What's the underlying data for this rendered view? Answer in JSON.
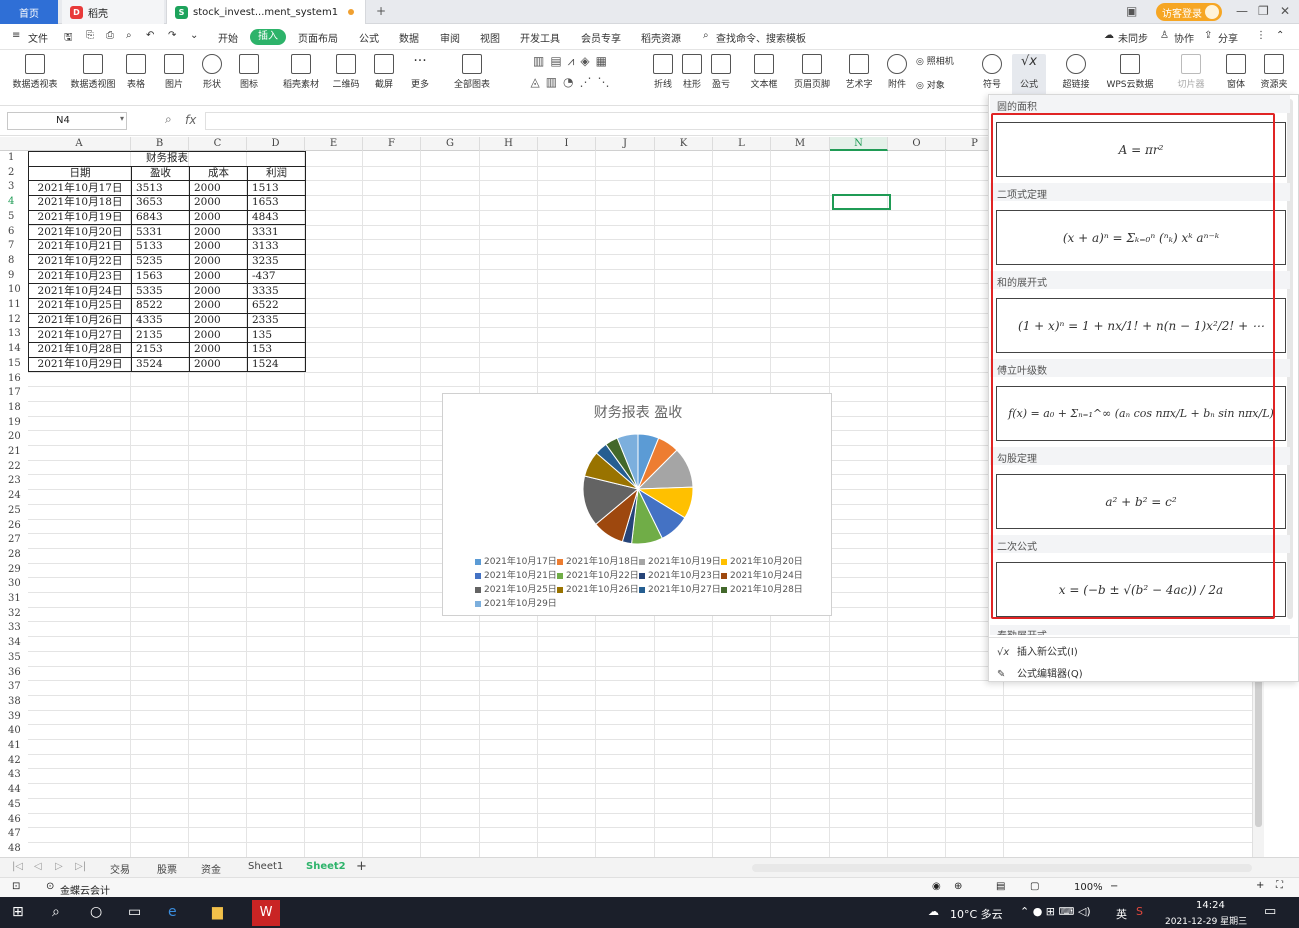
{
  "titlebar": {
    "tabs": [
      {
        "label": "首页"
      },
      {
        "label": "稻壳"
      },
      {
        "label": "stock_invest...ment_system1"
      }
    ],
    "new_tab": "+",
    "login": "访客登录"
  },
  "menubar": {
    "file": "文件",
    "items": [
      "开始",
      "插入",
      "页面布局",
      "公式",
      "数据",
      "审阅",
      "视图",
      "开发工具",
      "会员专享",
      "稻壳资源"
    ],
    "search": "查找命令、搜索模板",
    "unsync": "未同步",
    "collab": "协作",
    "share": "分享"
  },
  "ribbon": {
    "buttons": [
      "数据透视表",
      "数据透视图",
      "表格",
      "图片",
      "形状",
      "图标",
      "稻壳素材",
      "二维码",
      "截屏",
      "更多",
      "全部图表",
      "折线",
      "柱形",
      "盈亏",
      "文本框",
      "页眉页脚",
      "艺术字",
      "附件",
      "照相机",
      "对象",
      "符号",
      "公式",
      "超链接",
      "WPS云数据",
      "切片器",
      "窗体",
      "资源夹"
    ]
  },
  "formulabar": {
    "cell_ref": "N4",
    "fx": "fx"
  },
  "grid": {
    "columns": [
      "A",
      "B",
      "C",
      "D",
      "E",
      "F",
      "G",
      "H",
      "I",
      "J",
      "K",
      "L",
      "M",
      "N",
      "O",
      "P"
    ],
    "rows": [
      "1",
      "2",
      "3",
      "4",
      "5",
      "6",
      "7",
      "8",
      "9",
      "10",
      "11",
      "12",
      "13",
      "14",
      "15",
      "16",
      "17",
      "18",
      "19",
      "20",
      "21",
      "22",
      "23",
      "24",
      "25",
      "26",
      "27",
      "28",
      "29",
      "30",
      "31",
      "32",
      "33",
      "34",
      "35",
      "36",
      "37",
      "38",
      "39",
      "40",
      "41",
      "42",
      "43",
      "44",
      "45",
      "46",
      "47",
      "48"
    ]
  },
  "table": {
    "title": "财务报表",
    "headers": [
      "日期",
      "盈收",
      "成本",
      "利润"
    ],
    "rows": [
      [
        "2021年10月17日",
        "3513",
        "2000",
        "1513"
      ],
      [
        "2021年10月18日",
        "3653",
        "2000",
        "1653"
      ],
      [
        "2021年10月19日",
        "6843",
        "2000",
        "4843"
      ],
      [
        "2021年10月20日",
        "5331",
        "2000",
        "3331"
      ],
      [
        "2021年10月21日",
        "5133",
        "2000",
        "3133"
      ],
      [
        "2021年10月22日",
        "5235",
        "2000",
        "3235"
      ],
      [
        "2021年10月23日",
        "1563",
        "2000",
        "-437"
      ],
      [
        "2021年10月24日",
        "5335",
        "2000",
        "3335"
      ],
      [
        "2021年10月25日",
        "8522",
        "2000",
        "6522"
      ],
      [
        "2021年10月26日",
        "4335",
        "2000",
        "2335"
      ],
      [
        "2021年10月27日",
        "2135",
        "2000",
        "135"
      ],
      [
        "2021年10月28日",
        "2153",
        "2000",
        "153"
      ],
      [
        "2021年10月29日",
        "3524",
        "2000",
        "1524"
      ]
    ]
  },
  "chart_data": {
    "type": "pie",
    "title": "财务报表 盈收",
    "categories": [
      "2021年10月17日",
      "2021年10月18日",
      "2021年10月19日",
      "2021年10月20日",
      "2021年10月21日",
      "2021年10月22日",
      "2021年10月23日",
      "2021年10月24日",
      "2021年10月25日",
      "2021年10月26日",
      "2021年10月27日",
      "2021年10月28日",
      "2021年10月29日"
    ],
    "values": [
      3513,
      3653,
      6843,
      5331,
      5133,
      5235,
      1563,
      5335,
      8522,
      4335,
      2135,
      2153,
      3524
    ],
    "colors": [
      "#5b9bd5",
      "#ed7d31",
      "#a5a5a5",
      "#ffc000",
      "#4472c4",
      "#70ad47",
      "#264478",
      "#9e480e",
      "#636363",
      "#997300",
      "#255e91",
      "#43682b",
      "#7cafdd"
    ],
    "legend": "bottom"
  },
  "panel": {
    "sections": [
      {
        "title": "圆的面积",
        "formula": "A = πr²"
      },
      {
        "title": "二项式定理",
        "formula": "(x + a)ⁿ = Σₖ₌₀ⁿ (ⁿₖ) xᵏ aⁿ⁻ᵏ"
      },
      {
        "title": "和的展开式",
        "formula": "(1 + x)ⁿ = 1 + nx/1! + n(n − 1)x²/2! + ⋯"
      },
      {
        "title": "傅立叶级数",
        "formula": "f(x) = a₀ + Σₙ₌₁^∞ (aₙ cos nπx/L + bₙ sin nπx/L)"
      },
      {
        "title": "勾股定理",
        "formula": "a² + b² = c²"
      },
      {
        "title": "二次公式",
        "formula": "x = (−b ± √(b² − 4ac)) / 2a"
      }
    ],
    "cut_section": "泰勒展开式",
    "insert_new": "插入新公式(I)",
    "editor": "公式编辑器(Q)"
  },
  "sheets": {
    "tabs": [
      "交易",
      "股票",
      "资金",
      "Sheet1",
      "Sheet2"
    ],
    "active": "Sheet2"
  },
  "statusbar": {
    "plugin": "金蝶云会计",
    "zoom": "100%"
  },
  "taskbar": {
    "weather": "10°C 多云",
    "ime": "英",
    "time": "14:24",
    "date": "2021-12-29 星期三"
  }
}
